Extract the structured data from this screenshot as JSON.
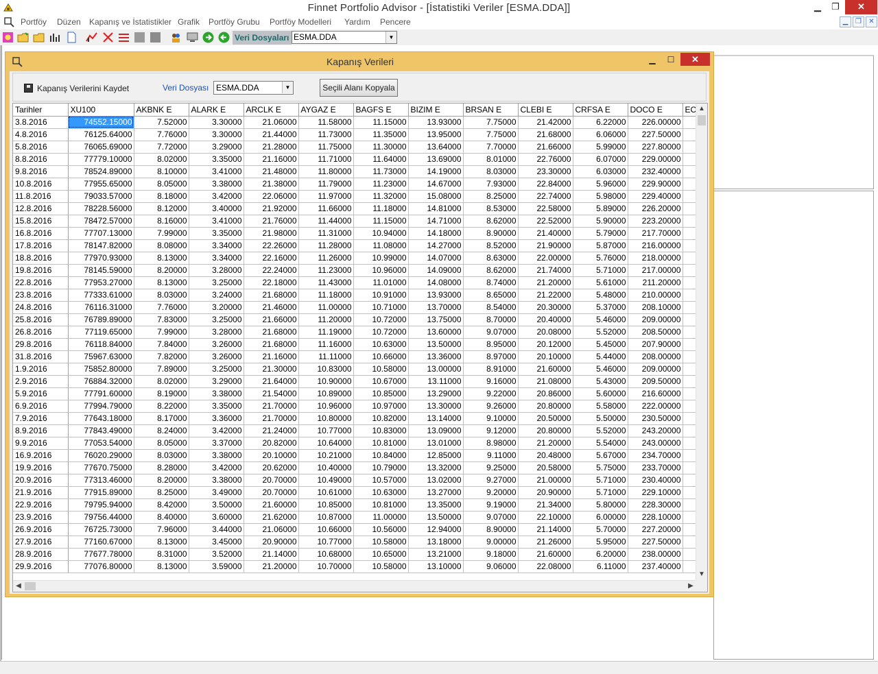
{
  "app": {
    "title": "Finnet Portfolio Advisor - [İstatistiki Veriler   [ESMA.DDA]]",
    "min": "▁",
    "max": "❐",
    "close": "✕"
  },
  "menu": {
    "items": [
      "Portföy",
      "Düzen",
      "Kapanış ve İstatistikler",
      "Grafik",
      "Portföy Grubu",
      "Portföy Modelleri",
      "Yardım",
      "Pencere"
    ],
    "mdi_min": "▁",
    "mdi_restore": "❐",
    "mdi_close": "✕"
  },
  "toolbar": {
    "veri_label": "Veri Dosyaları",
    "veri_value": "ESMA.DDA",
    "icons": [
      "new-portfolio-icon",
      "open-folder-icon",
      "open-folder-alt-icon",
      "chart-bars-icon",
      "document-icon",
      "candle-chart-icon",
      "scissors-chart-icon",
      "red-chart-icon",
      "disabled-icon-1",
      "disabled-icon-2",
      "people-icon",
      "monitor-icon",
      "forward-icon",
      "back-icon"
    ]
  },
  "child": {
    "title": "Kapanış Verileri",
    "min": "▁",
    "max": "☐",
    "close": "✕",
    "save_label": "Kapanış Verilerini Kaydet",
    "veri_dosyasi_label": "Veri Dosyası",
    "veri_dosyasi_value": "ESMA.DDA",
    "copy_button": "Seçili Alanı Kopyala"
  },
  "grid": {
    "columns": [
      "Tarihler",
      "XU100",
      "AKBNK E",
      "ALARK E",
      "ARCLK E",
      "AYGAZ E",
      "BAGFS E",
      "BIZIM E",
      "BRSAN E",
      "CLEBI E",
      "CRFSA E",
      "DOCO  E",
      "ECI"
    ],
    "rows": [
      [
        "3.8.2016",
        "74552.15000",
        "7.52000",
        "3.30000",
        "21.06000",
        "11.58000",
        "11.15000",
        "13.93000",
        "7.75000",
        "21.42000",
        "6.22000",
        "226.00000"
      ],
      [
        "4.8.2016",
        "76125.64000",
        "7.76000",
        "3.30000",
        "21.44000",
        "11.73000",
        "11.35000",
        "13.95000",
        "7.75000",
        "21.68000",
        "6.06000",
        "227.50000"
      ],
      [
        "5.8.2016",
        "76065.69000",
        "7.72000",
        "3.29000",
        "21.28000",
        "11.75000",
        "11.30000",
        "13.64000",
        "7.70000",
        "21.66000",
        "5.99000",
        "227.80000"
      ],
      [
        "8.8.2016",
        "77779.10000",
        "8.02000",
        "3.35000",
        "21.16000",
        "11.71000",
        "11.64000",
        "13.69000",
        "8.01000",
        "22.76000",
        "6.07000",
        "229.00000"
      ],
      [
        "9.8.2016",
        "78524.89000",
        "8.10000",
        "3.41000",
        "21.48000",
        "11.80000",
        "11.73000",
        "14.19000",
        "8.03000",
        "23.30000",
        "6.03000",
        "232.40000"
      ],
      [
        "10.8.2016",
        "77955.65000",
        "8.05000",
        "3.38000",
        "21.38000",
        "11.79000",
        "11.23000",
        "14.67000",
        "7.93000",
        "22.84000",
        "5.96000",
        "229.90000"
      ],
      [
        "11.8.2016",
        "79033.57000",
        "8.18000",
        "3.42000",
        "22.06000",
        "11.97000",
        "11.32000",
        "15.08000",
        "8.25000",
        "22.74000",
        "5.98000",
        "229.40000"
      ],
      [
        "12.8.2016",
        "78228.56000",
        "8.12000",
        "3.40000",
        "21.92000",
        "11.66000",
        "11.18000",
        "14.81000",
        "8.53000",
        "22.58000",
        "5.89000",
        "226.20000"
      ],
      [
        "15.8.2016",
        "78472.57000",
        "8.16000",
        "3.41000",
        "21.76000",
        "11.44000",
        "11.15000",
        "14.71000",
        "8.62000",
        "22.52000",
        "5.90000",
        "223.20000"
      ],
      [
        "16.8.2016",
        "77707.13000",
        "7.99000",
        "3.35000",
        "21.98000",
        "11.31000",
        "10.94000",
        "14.18000",
        "8.90000",
        "21.40000",
        "5.79000",
        "217.70000"
      ],
      [
        "17.8.2016",
        "78147.82000",
        "8.08000",
        "3.34000",
        "22.26000",
        "11.28000",
        "11.08000",
        "14.27000",
        "8.52000",
        "21.90000",
        "5.87000",
        "216.00000"
      ],
      [
        "18.8.2016",
        "77970.93000",
        "8.13000",
        "3.34000",
        "22.16000",
        "11.26000",
        "10.99000",
        "14.07000",
        "8.63000",
        "22.00000",
        "5.76000",
        "218.00000"
      ],
      [
        "19.8.2016",
        "78145.59000",
        "8.20000",
        "3.28000",
        "22.24000",
        "11.23000",
        "10.96000",
        "14.09000",
        "8.62000",
        "21.74000",
        "5.71000",
        "217.00000"
      ],
      [
        "22.8.2016",
        "77953.27000",
        "8.13000",
        "3.25000",
        "22.18000",
        "11.43000",
        "11.01000",
        "14.08000",
        "8.74000",
        "21.20000",
        "5.61000",
        "211.20000"
      ],
      [
        "23.8.2016",
        "77333.61000",
        "8.03000",
        "3.24000",
        "21.68000",
        "11.18000",
        "10.91000",
        "13.93000",
        "8.65000",
        "21.22000",
        "5.48000",
        "210.00000"
      ],
      [
        "24.8.2016",
        "76116.31000",
        "7.76000",
        "3.20000",
        "21.46000",
        "11.00000",
        "10.71000",
        "13.70000",
        "8.54000",
        "20.30000",
        "5.37000",
        "208.10000"
      ],
      [
        "25.8.2016",
        "76789.89000",
        "7.83000",
        "3.25000",
        "21.66000",
        "11.20000",
        "10.72000",
        "13.75000",
        "8.70000",
        "20.40000",
        "5.46000",
        "209.00000"
      ],
      [
        "26.8.2016",
        "77119.65000",
        "7.99000",
        "3.28000",
        "21.68000",
        "11.19000",
        "10.72000",
        "13.60000",
        "9.07000",
        "20.08000",
        "5.52000",
        "208.50000"
      ],
      [
        "29.8.2016",
        "76118.84000",
        "7.84000",
        "3.26000",
        "21.68000",
        "11.16000",
        "10.63000",
        "13.50000",
        "8.95000",
        "20.12000",
        "5.45000",
        "207.90000"
      ],
      [
        "31.8.2016",
        "75967.63000",
        "7.82000",
        "3.26000",
        "21.16000",
        "11.11000",
        "10.66000",
        "13.36000",
        "8.97000",
        "20.10000",
        "5.44000",
        "208.00000"
      ],
      [
        "1.9.2016",
        "75852.80000",
        "7.89000",
        "3.25000",
        "21.30000",
        "10.83000",
        "10.58000",
        "13.00000",
        "8.91000",
        "21.60000",
        "5.46000",
        "209.00000"
      ],
      [
        "2.9.2016",
        "76884.32000",
        "8.02000",
        "3.29000",
        "21.64000",
        "10.90000",
        "10.67000",
        "13.11000",
        "9.16000",
        "21.08000",
        "5.43000",
        "209.50000"
      ],
      [
        "5.9.2016",
        "77791.60000",
        "8.19000",
        "3.38000",
        "21.54000",
        "10.89000",
        "10.85000",
        "13.29000",
        "9.22000",
        "20.86000",
        "5.60000",
        "216.60000"
      ],
      [
        "6.9.2016",
        "77994.79000",
        "8.22000",
        "3.35000",
        "21.70000",
        "10.96000",
        "10.97000",
        "13.30000",
        "9.26000",
        "20.80000",
        "5.58000",
        "222.00000"
      ],
      [
        "7.9.2016",
        "77643.18000",
        "8.17000",
        "3.36000",
        "21.70000",
        "10.80000",
        "10.82000",
        "13.14000",
        "9.10000",
        "20.50000",
        "5.50000",
        "230.50000"
      ],
      [
        "8.9.2016",
        "77843.49000",
        "8.24000",
        "3.42000",
        "21.24000",
        "10.77000",
        "10.83000",
        "13.09000",
        "9.12000",
        "20.80000",
        "5.52000",
        "243.20000"
      ],
      [
        "9.9.2016",
        "77053.54000",
        "8.05000",
        "3.37000",
        "20.82000",
        "10.64000",
        "10.81000",
        "13.01000",
        "8.98000",
        "21.20000",
        "5.54000",
        "243.00000"
      ],
      [
        "16.9.2016",
        "76020.29000",
        "8.03000",
        "3.38000",
        "20.10000",
        "10.21000",
        "10.84000",
        "12.85000",
        "9.11000",
        "20.48000",
        "5.67000",
        "234.70000"
      ],
      [
        "19.9.2016",
        "77670.75000",
        "8.28000",
        "3.42000",
        "20.62000",
        "10.40000",
        "10.79000",
        "13.32000",
        "9.25000",
        "20.58000",
        "5.75000",
        "233.70000"
      ],
      [
        "20.9.2016",
        "77313.46000",
        "8.20000",
        "3.38000",
        "20.70000",
        "10.49000",
        "10.57000",
        "13.02000",
        "9.27000",
        "21.00000",
        "5.71000",
        "230.40000"
      ],
      [
        "21.9.2016",
        "77915.89000",
        "8.25000",
        "3.49000",
        "20.70000",
        "10.61000",
        "10.63000",
        "13.27000",
        "9.20000",
        "20.90000",
        "5.71000",
        "229.10000"
      ],
      [
        "22.9.2016",
        "79795.94000",
        "8.42000",
        "3.50000",
        "21.60000",
        "10.85000",
        "10.81000",
        "13.35000",
        "9.19000",
        "21.34000",
        "5.80000",
        "228.30000"
      ],
      [
        "23.9.2016",
        "79756.44000",
        "8.40000",
        "3.60000",
        "21.62000",
        "10.87000",
        "11.00000",
        "13.50000",
        "9.07000",
        "22.10000",
        "6.00000",
        "228.10000"
      ],
      [
        "26.9.2016",
        "76725.73000",
        "7.96000",
        "3.44000",
        "21.06000",
        "10.66000",
        "10.56000",
        "12.94000",
        "8.90000",
        "21.14000",
        "5.70000",
        "227.20000"
      ],
      [
        "27.9.2016",
        "77160.67000",
        "8.13000",
        "3.45000",
        "20.90000",
        "10.77000",
        "10.58000",
        "13.18000",
        "9.00000",
        "21.26000",
        "5.95000",
        "227.50000"
      ],
      [
        "28.9.2016",
        "77677.78000",
        "8.31000",
        "3.52000",
        "21.14000",
        "10.68000",
        "10.65000",
        "13.21000",
        "9.18000",
        "21.60000",
        "6.20000",
        "238.00000"
      ],
      [
        "29.9.2016",
        "77076.80000",
        "8.13000",
        "3.59000",
        "21.20000",
        "10.70000",
        "10.58000",
        "13.10000",
        "9.06000",
        "22.08000",
        "6.11000",
        "237.40000"
      ]
    ]
  }
}
